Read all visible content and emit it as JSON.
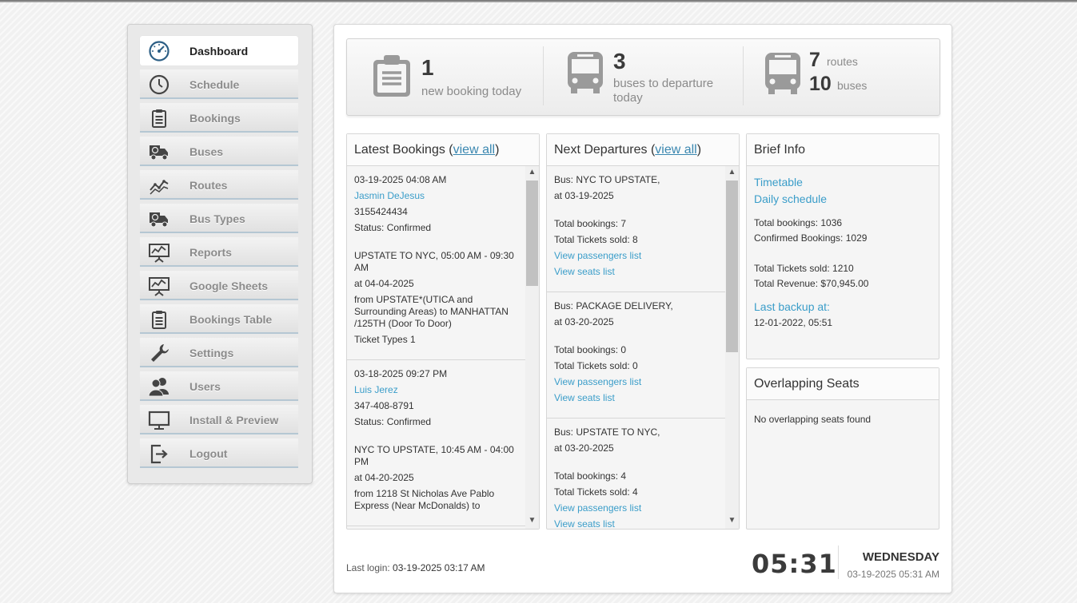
{
  "sidebar": {
    "items": [
      {
        "label": "Dashboard",
        "icon": "dashboard-gauge-icon",
        "active": true
      },
      {
        "label": "Schedule",
        "icon": "clock-icon"
      },
      {
        "label": "Bookings",
        "icon": "clipboard-icon"
      },
      {
        "label": "Buses",
        "icon": "truck-icon"
      },
      {
        "label": "Routes",
        "icon": "route-graph-icon"
      },
      {
        "label": "Bus Types",
        "icon": "truck-icon"
      },
      {
        "label": "Reports",
        "icon": "presentation-chart-icon"
      },
      {
        "label": "Google Sheets",
        "icon": "presentation-chart-icon"
      },
      {
        "label": "Bookings Table",
        "icon": "clipboard-icon"
      },
      {
        "label": "Settings",
        "icon": "wrench-icon"
      },
      {
        "label": "Users",
        "icon": "users-icon"
      },
      {
        "label": "Install & Preview",
        "icon": "monitor-icon"
      },
      {
        "label": "Logout",
        "icon": "logout-icon"
      }
    ]
  },
  "stats": {
    "bookings": {
      "number": "1",
      "text": "new booking today",
      "icon": "clipboard-icon"
    },
    "departures": {
      "number": "3",
      "text_line1": "buses to departure",
      "text_line2": "today",
      "icon": "bus-icon"
    },
    "fleet": {
      "routes_number": "7",
      "routes_label": "routes",
      "buses_number": "10",
      "buses_label": "buses",
      "icon": "bus-icon"
    }
  },
  "latest_bookings": {
    "title": "Latest Bookings (",
    "view_all": "view all",
    "title_end": ")",
    "entries": [
      {
        "datetime": "03-19-2025 04:08 AM",
        "name": "Jasmin DeJesus",
        "phone": "3155424434",
        "status": "Status: Confirmed",
        "route": "UPSTATE TO NYC, 05:00 AM - 09:30 AM",
        "date": "at 04-04-2025",
        "from": "from UPSTATE*(UTICA and Surrounding Areas) to MANHATTAN /125TH (Door To Door)",
        "tickets": "Ticket Types 1"
      },
      {
        "datetime": "03-18-2025 09:27 PM",
        "name": "Luis Jerez",
        "phone": "347-408-8791",
        "status": "Status: Confirmed",
        "route": "NYC TO UPSTATE, 10:45 AM - 04:00 PM",
        "date": "at 04-20-2025",
        "from": "from 1218 St Nicholas Ave Pablo Express (Near McDonalds) to",
        "tickets": ""
      }
    ]
  },
  "next_departures": {
    "title": "Next Departures (",
    "view_all": "view all",
    "title_end": ")",
    "entries": [
      {
        "bus": "Bus: NYC TO UPSTATE,",
        "date": "at 03-19-2025",
        "total_bookings": "Total bookings: 7",
        "tickets": "Total Tickets sold: 8",
        "passengers_link": "View passengers list",
        "seats_link": "View seats list"
      },
      {
        "bus": "Bus: PACKAGE DELIVERY,",
        "date": "at 03-20-2025",
        "total_bookings": "Total bookings: 0",
        "tickets": "Total Tickets sold: 0",
        "passengers_link": "View passengers list",
        "seats_link": "View seats list"
      },
      {
        "bus": "Bus: UPSTATE TO NYC,",
        "date": "at 03-20-2025",
        "total_bookings": "Total bookings: 4",
        "tickets": "Total Tickets sold: 4",
        "passengers_link": "View passengers list",
        "seats_link": "View seats list"
      }
    ]
  },
  "brief_info": {
    "title": "Brief Info",
    "timetable": "Timetable",
    "daily_schedule": "Daily schedule",
    "total_bookings": "Total bookings: 1036",
    "confirmed": "Confirmed Bookings: 1029",
    "tickets": "Total Tickets sold: 1210",
    "revenue": "Total Revenue: $70,945.00",
    "backup_label": "Last backup at:",
    "backup_value": "12-01-2022, 05:51"
  },
  "overlapping": {
    "title": "Overlapping Seats",
    "text": "No overlapping seats found"
  },
  "footer": {
    "login_label": "Last login: ",
    "login_value": "03-19-2025 03:17 AM",
    "time": "05:31",
    "day": "WEDNESDAY",
    "datetime": "03-19-2025 05:31 AM"
  },
  "colors": {
    "link": "#3a9dc9",
    "icon_grey": "#8e8e8e",
    "nav_icon": "#444"
  }
}
